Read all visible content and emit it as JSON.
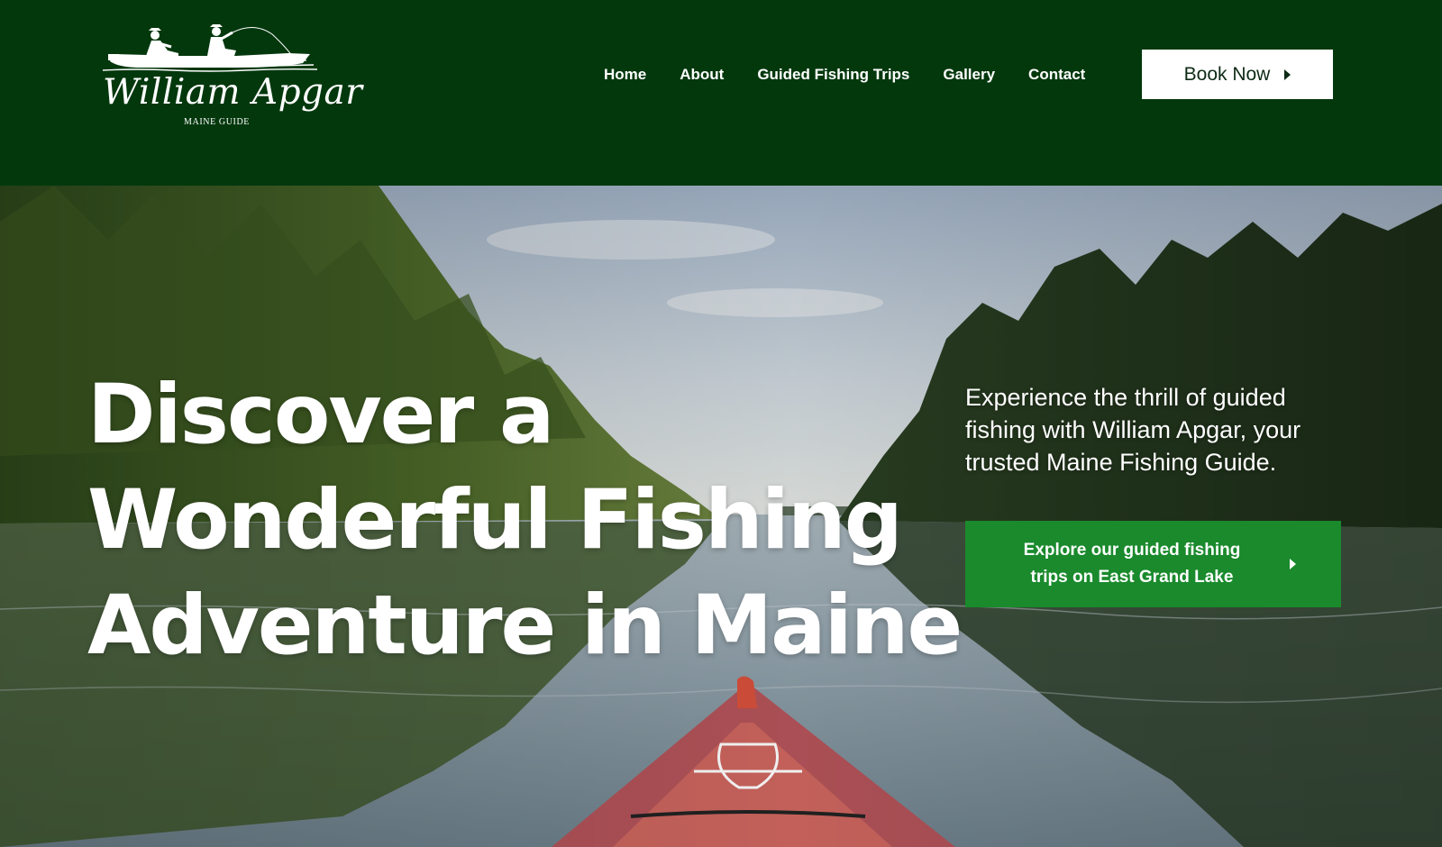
{
  "brand": {
    "logo_name": "William Apgar",
    "logo_subtitle": "MAINE GUIDE",
    "header_color": "#03380d"
  },
  "nav": {
    "items": [
      {
        "label": "Home"
      },
      {
        "label": "About"
      },
      {
        "label": "Guided Fishing Trips"
      },
      {
        "label": "Gallery"
      },
      {
        "label": "Contact"
      }
    ],
    "book_button": {
      "label": "Book Now",
      "icon": "caret-right-icon"
    }
  },
  "hero": {
    "title_lines": [
      "Discover a",
      "Wonderful Fishing",
      "Adventure in Maine"
    ],
    "description": "Experience the thrill of guided fishing with William Apgar, your trusted Maine Fishing Guide.",
    "cta": {
      "label": "Explore our guided fishing trips on East Grand Lake",
      "icon": "caret-right-icon",
      "color": "#1a8a2c"
    }
  }
}
